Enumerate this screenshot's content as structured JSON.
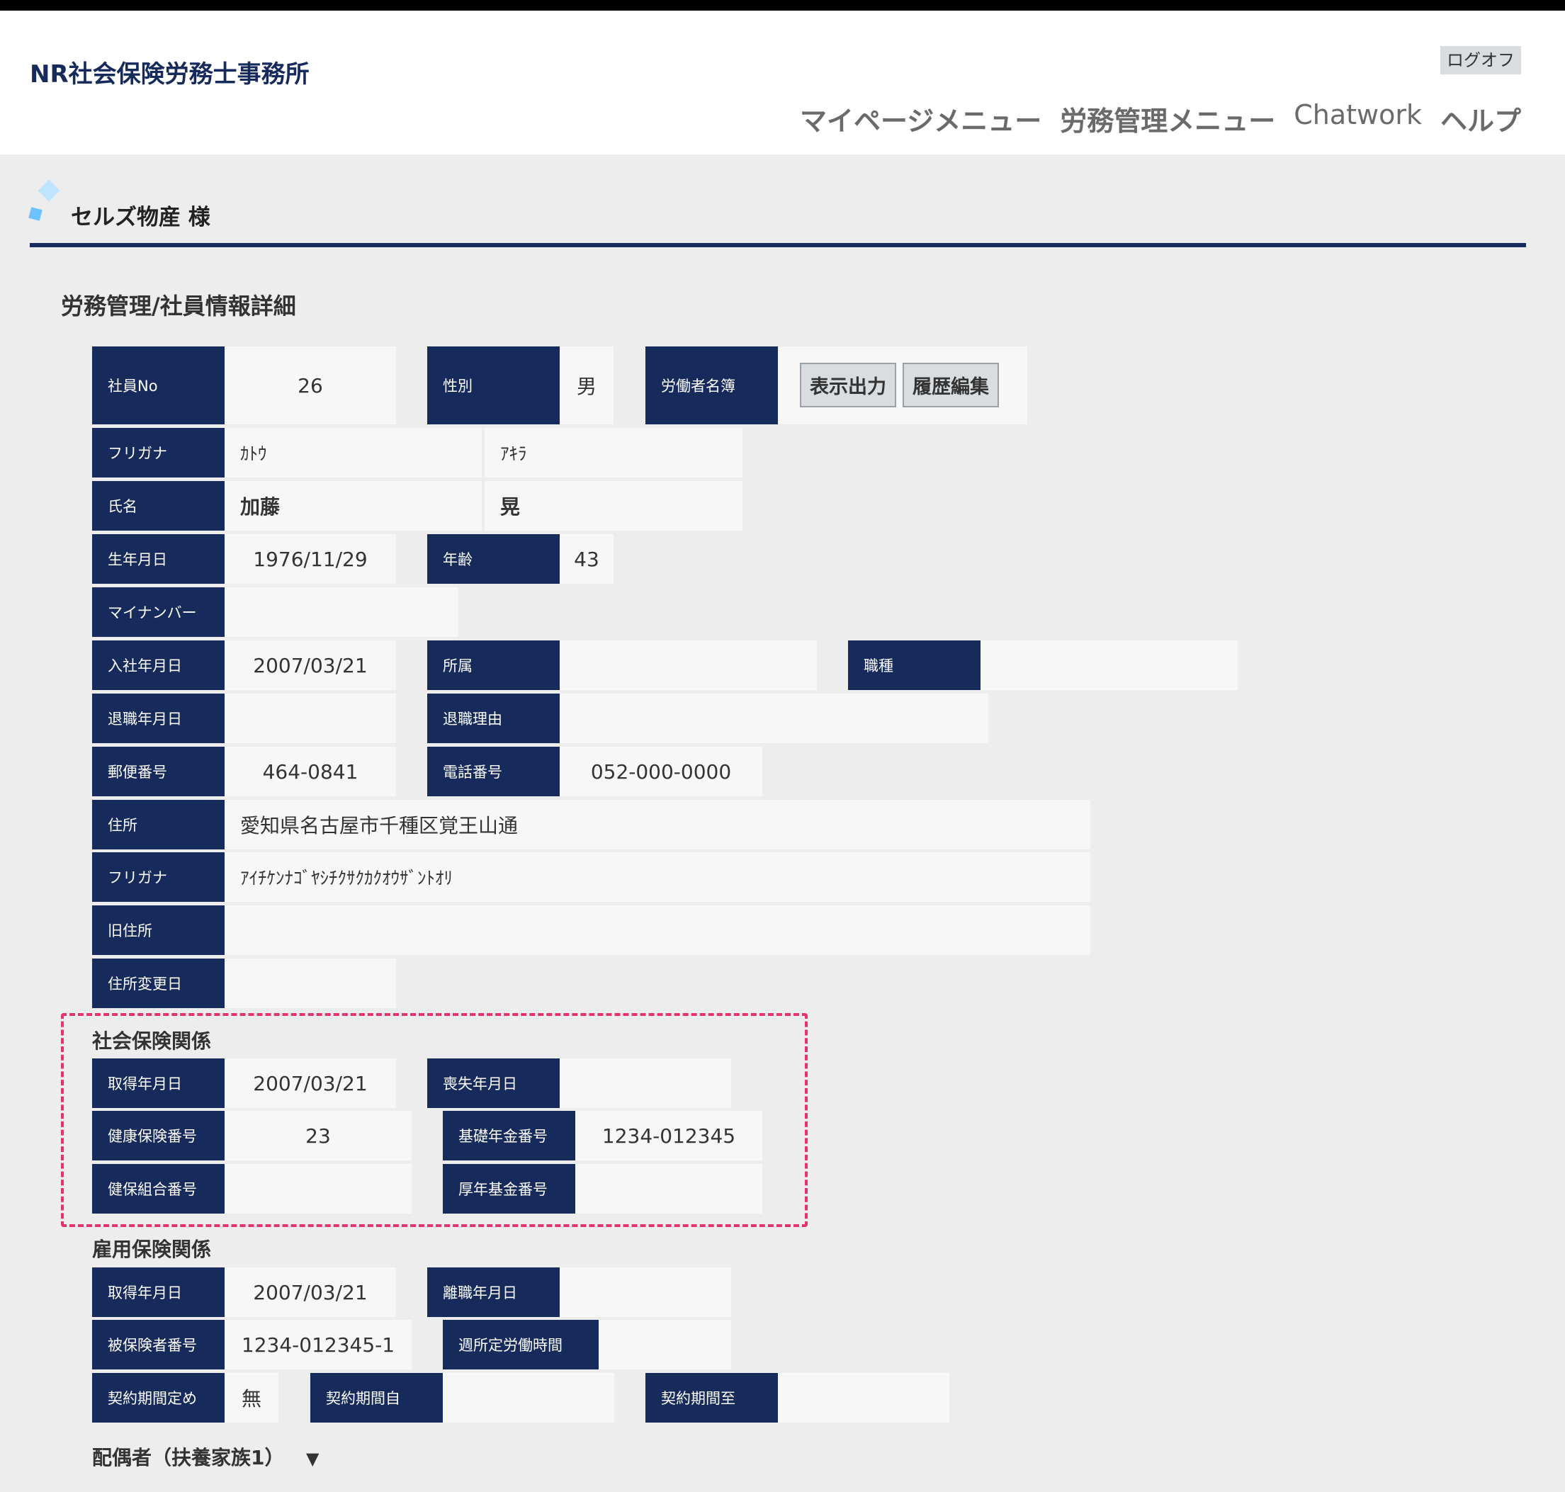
{
  "header": {
    "office_name": "NR社会保険労務士事務所",
    "logoff": "ログオフ",
    "nav": [
      "マイページメニュー",
      "労務管理メニュー",
      "Chatwork",
      "ヘルプ"
    ]
  },
  "company": {
    "name": "セルズ物産 様"
  },
  "page_title": "労務管理/社員情報詳細",
  "employee": {
    "emp_no_label": "社員No",
    "emp_no": "26",
    "gender_label": "性別",
    "gender": "男",
    "roster_label": "労働者名簿",
    "btn_display": "表示出力",
    "btn_history": "履歴編集",
    "furigana_label": "フリガナ",
    "furigana_last": "ｶﾄｳ",
    "furigana_first": "ｱｷﾗ",
    "name_label": "氏名",
    "name_last": "加藤",
    "name_first": "晃",
    "birth_label": "生年月日",
    "birth": "1976/11/29",
    "age_label": "年齢",
    "age": "43",
    "mynumber_label": "マイナンバー",
    "mynumber": "",
    "join_label": "入社年月日",
    "join": "2007/03/21",
    "dept_label": "所属",
    "dept": "",
    "job_label": "職種",
    "job": "",
    "retire_label": "退職年月日",
    "retire": "",
    "retire_reason_label": "退職理由",
    "retire_reason": "",
    "zip_label": "郵便番号",
    "zip": "464-0841",
    "tel_label": "電話番号",
    "tel": "052-000-0000",
    "address_label": "住所",
    "address": "愛知県名古屋市千種区覚王山通",
    "address_kana_label": "フリガナ",
    "address_kana": "ｱｲﾁｹﾝﾅｺﾞﾔｼﾁｸｻｸｶｸｵｳｻﾞﾝﾄｵﾘ",
    "old_address_label": "旧住所",
    "old_address": "",
    "address_change_label": "住所変更日",
    "address_change": ""
  },
  "social_insurance": {
    "title": "社会保険関係",
    "acquired_label": "取得年月日",
    "acquired": "2007/03/21",
    "lost_label": "喪失年月日",
    "lost": "",
    "health_no_label": "健康保険番号",
    "health_no": "23",
    "pension_no_label": "基礎年金番号",
    "pension_no": "1234-012345",
    "union_no_label": "健保組合番号",
    "union_no": "",
    "fund_no_label": "厚年基金番号",
    "fund_no": ""
  },
  "employment_insurance": {
    "title": "雇用保険関係",
    "acquired_label": "取得年月日",
    "acquired": "2007/03/21",
    "left_label": "離職年月日",
    "left": "",
    "insured_no_label": "被保険者番号",
    "insured_no": "1234-012345-1",
    "weekly_hours_label": "週所定労働時間",
    "weekly_hours": "",
    "contract_fixed_label": "契約期間定め",
    "contract_fixed": "無",
    "contract_from_label": "契約期間自",
    "contract_from": "",
    "contract_to_label": "契約期間至",
    "contract_to": ""
  },
  "dependents": {
    "title": "配偶者（扶養家族1）",
    "arrow": "▼"
  }
}
